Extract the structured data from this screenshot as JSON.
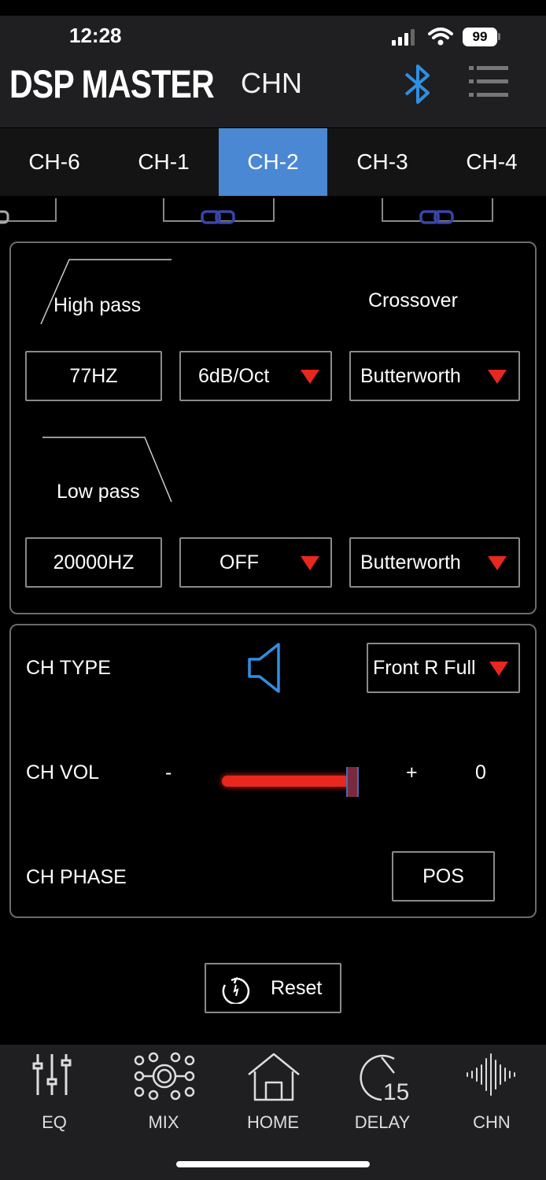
{
  "status_bar": {
    "time": "12:28",
    "battery": "99"
  },
  "header": {
    "app_title": "DSP MASTER",
    "page_label": "CHN",
    "bluetooth_icon": "bluetooth-icon",
    "menu_icon": "menu-icon"
  },
  "tabs": [
    {
      "label": "CH-6",
      "active": false
    },
    {
      "label": "CH-1",
      "active": false
    },
    {
      "label": "CH-2",
      "active": true
    },
    {
      "label": "CH-3",
      "active": false
    },
    {
      "label": "CH-4",
      "active": false
    }
  ],
  "crossover": {
    "title": "Crossover",
    "high_pass": {
      "label": "High pass",
      "frequency": "77HZ",
      "slope": "6dB/Oct",
      "type": "Butterworth"
    },
    "low_pass": {
      "label": "Low pass",
      "frequency": "20000HZ",
      "slope": "OFF",
      "type": "Butterworth"
    }
  },
  "channel": {
    "type_label": "CH TYPE",
    "type_value": "Front R Full",
    "speaker_icon": "speaker-icon",
    "vol_label": "CH VOL",
    "vol_minus": "-",
    "vol_plus": "+",
    "vol_value": "0",
    "vol_level": 1.0,
    "phase_label": "CH PHASE",
    "phase_value": "POS"
  },
  "reset_label": "Reset",
  "bottom_nav": [
    {
      "label": "EQ",
      "icon": "eq-sliders-icon"
    },
    {
      "label": "MIX",
      "icon": "mix-network-icon"
    },
    {
      "label": "HOME",
      "icon": "home-icon"
    },
    {
      "label": "DELAY",
      "icon": "delay-timer-icon",
      "badge": "15"
    },
    {
      "label": "CHN",
      "icon": "waveform-icon"
    }
  ],
  "colors": {
    "accent": "#4a88d4",
    "dropdown_arrow": "#e8271f",
    "slider": "#e8271f",
    "link": "#3a45a8"
  }
}
